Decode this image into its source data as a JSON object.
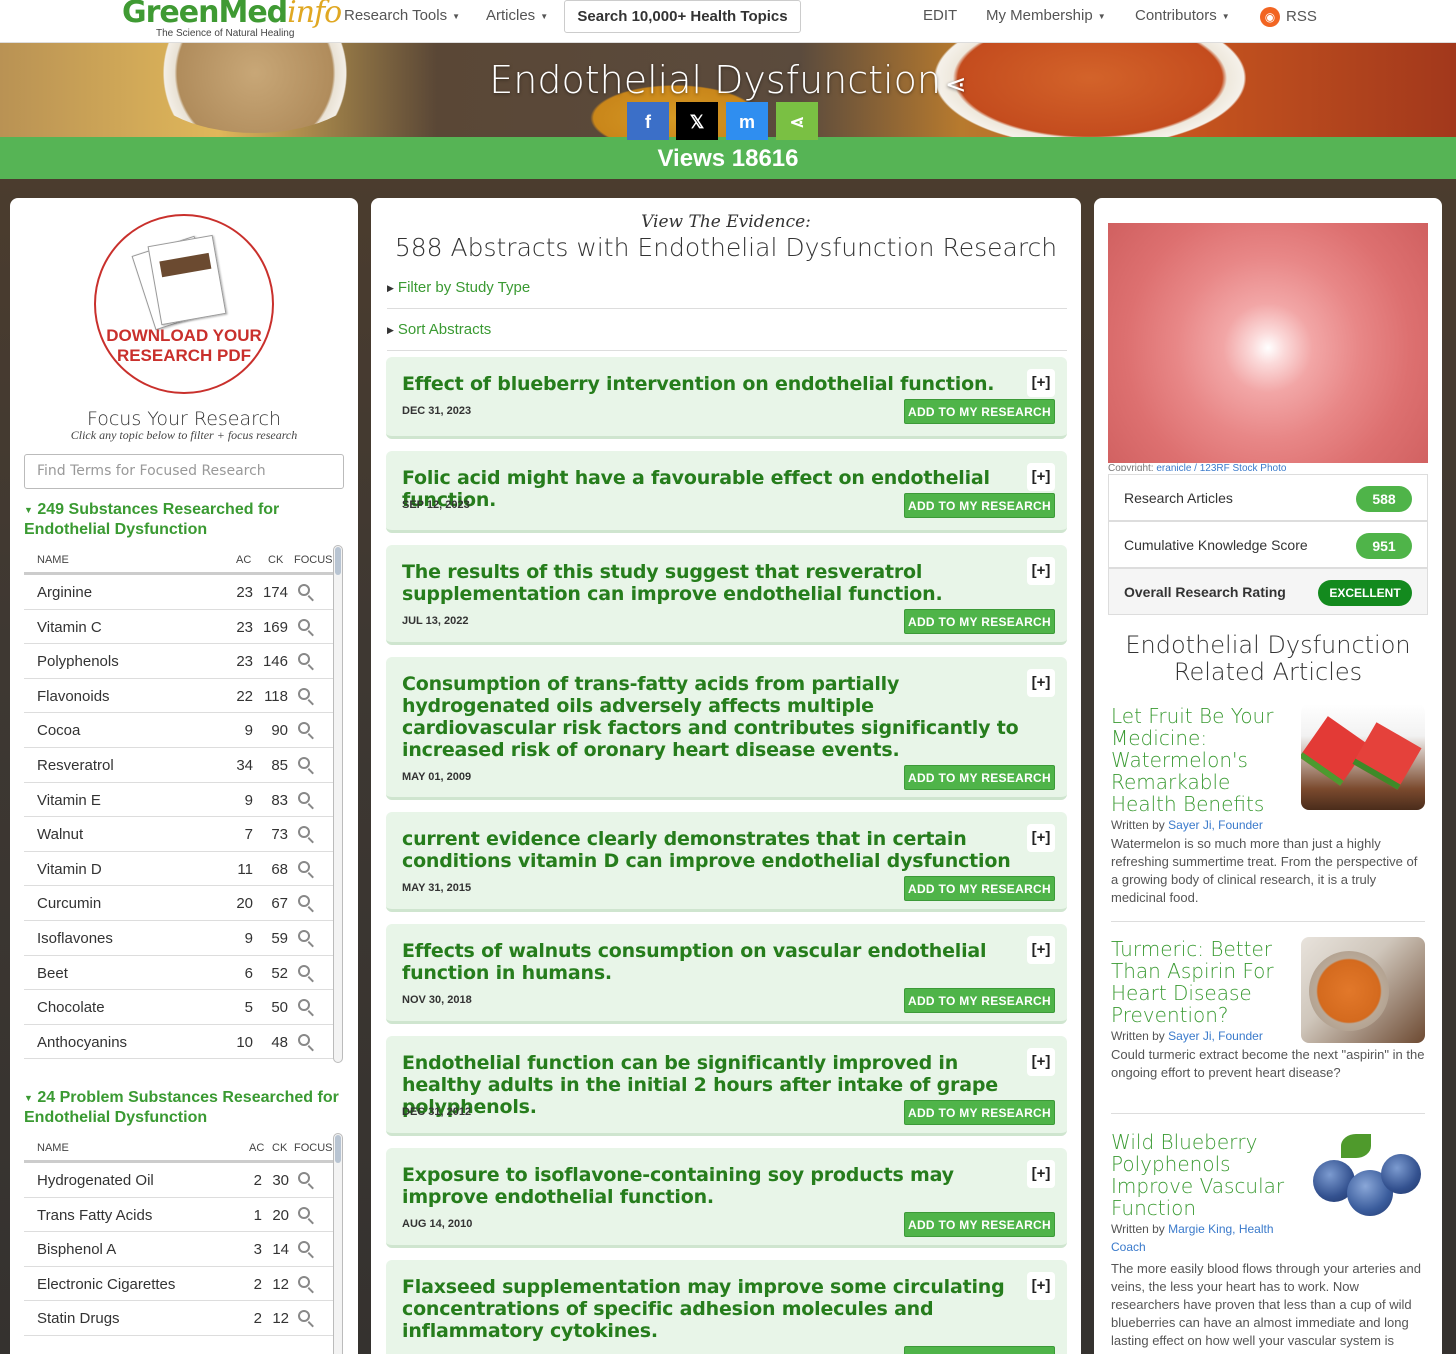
{
  "nav": {
    "logo_main": "GreenMed",
    "logo_accent": "info",
    "logo_tagline": "The Science of Natural Healing",
    "research_tools": "Research Tools",
    "articles": "Articles",
    "search": "Search 10,000+ Health Topics",
    "edit": "EDIT",
    "membership": "My Membership",
    "contributors": "Contributors",
    "rss": "RSS"
  },
  "hero": {
    "title": "Endothelial Dysfunction",
    "views": "Views 18616"
  },
  "share": {
    "facebook": "f",
    "x": "𝕏",
    "messenger": "m",
    "share": "⋖"
  },
  "left": {
    "download": "DOWNLOAD YOUR RESEARCH PDF",
    "focus_title": "Focus Your Research",
    "focus_sub": "Click any topic below to filter + focus research",
    "search_placeholder": "Find Terms for Focused Research",
    "substances_heading": "249 Substances Researched for Endothelial Dysfunction",
    "col_name": "NAME",
    "col_ac": "AC",
    "col_ck": "CK",
    "col_focus": "FOCUS",
    "substances": [
      {
        "name": "Arginine",
        "ac": "23",
        "ck": "174"
      },
      {
        "name": "Vitamin C",
        "ac": "23",
        "ck": "169"
      },
      {
        "name": "Polyphenols",
        "ac": "23",
        "ck": "146"
      },
      {
        "name": "Flavonoids",
        "ac": "22",
        "ck": "118"
      },
      {
        "name": "Cocoa",
        "ac": "9",
        "ck": "90"
      },
      {
        "name": "Resveratrol",
        "ac": "34",
        "ck": "85"
      },
      {
        "name": "Vitamin E",
        "ac": "9",
        "ck": "83"
      },
      {
        "name": "Walnut",
        "ac": "7",
        "ck": "73"
      },
      {
        "name": "Vitamin D",
        "ac": "11",
        "ck": "68"
      },
      {
        "name": "Curcumin",
        "ac": "20",
        "ck": "67"
      },
      {
        "name": "Isoflavones",
        "ac": "9",
        "ck": "59"
      },
      {
        "name": "Beet",
        "ac": "6",
        "ck": "52"
      },
      {
        "name": "Chocolate",
        "ac": "5",
        "ck": "50"
      },
      {
        "name": "Anthocyanins",
        "ac": "10",
        "ck": "48"
      }
    ],
    "problems_heading": "24 Problem Substances Researched for Endothelial Dysfunction",
    "problems": [
      {
        "name": "Hydrogenated Oil",
        "ac": "2",
        "ck": "30"
      },
      {
        "name": "Trans Fatty Acids",
        "ac": "1",
        "ck": "20"
      },
      {
        "name": "Bisphenol A",
        "ac": "3",
        "ck": "14"
      },
      {
        "name": "Electronic Cigarettes",
        "ac": "2",
        "ck": "12"
      },
      {
        "name": "Statin Drugs",
        "ac": "2",
        "ck": "12"
      }
    ]
  },
  "center": {
    "view_evidence": "View The Evidence:",
    "abstracts_heading": "588 Abstracts with Endothelial Dysfunction Research",
    "filter": "Filter by Study Type",
    "sort": "Sort Abstracts",
    "add_label": "ADD TO MY RESEARCH",
    "plus_label": "[+]",
    "abstracts": [
      {
        "title": "Effect of blueberry intervention on endothelial function.",
        "date": "DEC 31, 2023"
      },
      {
        "title": "Folic acid might have a favourable effect on endothelial function.",
        "date": "SEP 12, 2023"
      },
      {
        "title": "The results of this study suggest that resveratrol supplementation can improve endothelial function.",
        "date": "JUL 13, 2022"
      },
      {
        "title": "Consumption of trans-fatty acids from partially hydrogenated oils adversely affects multiple cardiovascular risk factors and contributes significantly to increased risk of oronary heart disease events.",
        "date": "MAY 01, 2009"
      },
      {
        "title": "current evidence clearly demonstrates that in certain conditions vitamin D can improve endothelial dysfunction",
        "date": "MAY 31, 2015"
      },
      {
        "title": "Effects of walnuts consumption on vascular endothelial function in humans.",
        "date": "NOV 30, 2018"
      },
      {
        "title": "Endothelial function can be significantly improved in healthy adults in the initial 2 hours after intake of grape polyphenols.",
        "date": "DEC 31, 2012"
      },
      {
        "title": "Exposure to isoflavone-containing soy products may improve endothelial function.",
        "date": "AUG 14, 2010"
      },
      {
        "title": "Flaxseed supplementation may improve some circulating concentrations of specific adhesion molecules and inflammatory cytokines.",
        "date": ""
      }
    ]
  },
  "right": {
    "copyright_prefix": "Copyright: ",
    "copyright_link": "eranicle / 123RF Stock Photo",
    "research_articles_label": "Research Articles",
    "research_articles_value": "588",
    "cks_label": "Cumulative Knowledge Score",
    "cks_value": "951",
    "rating_label": "Overall Research Rating",
    "rating_value": "EXCELLENT",
    "related_heading": "Endothelial Dysfunction Related Articles",
    "written_by": "Written by",
    "articles": [
      {
        "title": "Let Fruit Be Your Medicine: Watermelon's Remarkable Health Benefits",
        "author": "Sayer Ji, Founder",
        "excerpt": "Watermelon is so much more than just a highly refreshing summertime treat. From the perspective of a growing body of clinical research, it is a truly medicinal food."
      },
      {
        "title": "Turmeric: Better Than Aspirin For Heart Disease Prevention?",
        "author": "Sayer Ji, Founder",
        "excerpt": "Could turmeric extract become the next \"aspirin\" in the ongoing effort to prevent heart disease?"
      },
      {
        "title": "Wild Blueberry Polyphenols Improve Vascular Function",
        "author": "Margie King, Health Coach",
        "excerpt": "The more easily blood flows through your arteries and veins, the less your heart has to work. Now researchers have proven that less than a cup of wild blueberries can have an almost immediate and long lasting effect on how well your vascular system is"
      }
    ]
  },
  "colors": {
    "brand_green": "#3a9a32",
    "views_bar": "#56b455",
    "title_green": "#267d1c",
    "card_bg": "#e8f5e8",
    "download_red": "#c9302c"
  }
}
